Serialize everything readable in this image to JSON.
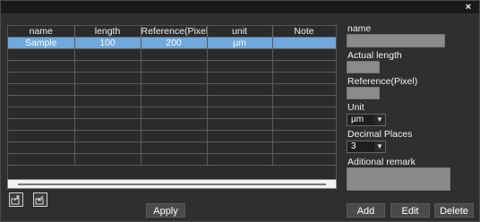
{
  "window": {
    "close_symbol": "×"
  },
  "table": {
    "columns": [
      "name",
      "length",
      "Reference(Pixel)",
      "unit",
      "Note"
    ],
    "rows": [
      [
        "Sample",
        "100",
        "200",
        "µm",
        ""
      ]
    ],
    "empty_rows": 10,
    "selected_row_color": "#6fa8dc"
  },
  "toolbar": {
    "export_icon": "export-icon",
    "import_icon": "import-icon",
    "apply_label": "Apply"
  },
  "form": {
    "name_label": "name",
    "name_value": "",
    "actual_length_label": "Actual length",
    "actual_length_value": "",
    "reference_label": "Reference(Pixel)",
    "reference_value": "",
    "unit_label": "Unit",
    "unit_value": "µm",
    "decimal_label": "Decimal Places",
    "decimal_value": "3",
    "remark_label": "Aditional remark",
    "remark_value": ""
  },
  "actions": {
    "add_label": "Add",
    "edit_label": "Edit",
    "delete_label": "Delete"
  }
}
